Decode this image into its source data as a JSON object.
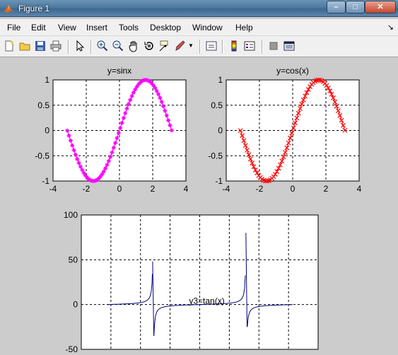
{
  "window": {
    "title": "Figure 1",
    "min_label": "–",
    "max_label": "□",
    "close_label": "✕"
  },
  "menu": {
    "items": [
      "File",
      "Edit",
      "View",
      "Insert",
      "Tools",
      "Desktop",
      "Window",
      "Help"
    ],
    "overflow_icon": "dock-arrow-icon"
  },
  "toolbar": {
    "icons": [
      "new-figure-icon",
      "open-file-icon",
      "save-icon",
      "print-icon",
      "edit-plot-arrow-icon",
      "zoom-in-icon",
      "zoom-out-icon",
      "pan-hand-icon",
      "rotate-3d-icon",
      "data-cursor-icon",
      "brush-icon",
      "link-plot-icon",
      "colorbar-icon",
      "legend-icon",
      "hide-plot-tools-icon",
      "show-plot-tools-icon"
    ]
  },
  "colors": {
    "sin": "#ff00ff",
    "cos": "#ff0000",
    "tan": "#00007f",
    "grid": "#000000"
  },
  "chart_data": [
    {
      "type": "line",
      "title": "y=sinx",
      "function": "sin",
      "x": [
        -3.14,
        -2.83,
        -2.51,
        -2.2,
        -1.88,
        -1.57,
        -1.26,
        -0.94,
        -0.63,
        -0.31,
        0,
        0.31,
        0.63,
        0.94,
        1.26,
        1.57,
        1.88,
        2.2,
        2.51,
        2.83,
        3.14
      ],
      "y": [
        0,
        -0.31,
        -0.59,
        -0.81,
        -0.95,
        -1,
        -0.95,
        -0.81,
        -0.59,
        -0.31,
        0,
        0.31,
        0.59,
        0.81,
        0.95,
        1,
        0.95,
        0.81,
        0.59,
        0.31,
        0
      ],
      "xlim": [
        -4,
        4
      ],
      "ylim": [
        -1,
        1
      ],
      "xticks": [
        "-4",
        "-2",
        "0",
        "2",
        "4"
      ],
      "yticks": [
        "1",
        "0.5",
        "0",
        "-0.5",
        "-1"
      ],
      "grid": true,
      "marker": "*"
    },
    {
      "type": "line",
      "title": "y=cos(x)",
      "function": "sin",
      "x": [
        -3.14,
        -2.83,
        -2.51,
        -2.2,
        -1.88,
        -1.57,
        -1.26,
        -0.94,
        -0.63,
        -0.31,
        0,
        0.31,
        0.63,
        0.94,
        1.26,
        1.57,
        1.88,
        2.2,
        2.51,
        2.83,
        3.14
      ],
      "y": [
        0,
        -0.31,
        -0.59,
        -0.81,
        -0.95,
        -1,
        -0.95,
        -0.81,
        -0.59,
        -0.31,
        0,
        0.31,
        0.59,
        0.81,
        0.95,
        1,
        0.95,
        0.81,
        0.59,
        0.31,
        0
      ],
      "xlim": [
        -4,
        4
      ],
      "ylim": [
        -1,
        1
      ],
      "xticks": [
        "-4",
        "-2",
        "0",
        "2",
        "4"
      ],
      "yticks": [
        "1",
        "0.5",
        "0",
        "-0.5",
        "-1"
      ],
      "grid": true,
      "marker": "x"
    },
    {
      "type": "line",
      "title": "",
      "annotation": "y3=tan(x)",
      "function": "tan",
      "xlim": [
        -4,
        4
      ],
      "ylim": [
        -50,
        100
      ],
      "yticks": [
        "100",
        "50",
        "0",
        "-50"
      ],
      "grid": true,
      "peaks": [
        {
          "x": -1.57,
          "max": 48,
          "min": -35
        },
        {
          "x": 1.57,
          "max": 80,
          "min": -25
        }
      ]
    }
  ]
}
